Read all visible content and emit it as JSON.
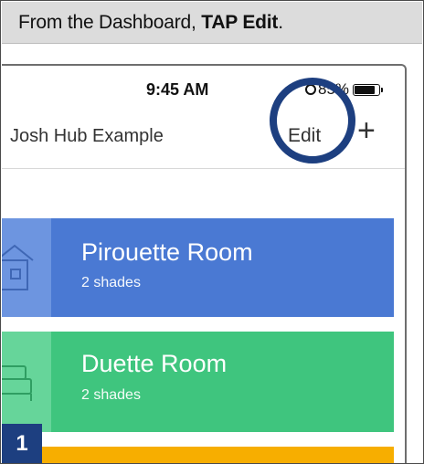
{
  "instruction": {
    "prefix": "From the Dashboard, ",
    "emphasis": "TAP Edit",
    "suffix": "."
  },
  "status_bar": {
    "time": "9:45 AM",
    "battery_percent_text": "85%",
    "battery_level": 0.85
  },
  "nav": {
    "hub_name": "Josh Hub Example",
    "edit_label": "Edit",
    "add_label": "+"
  },
  "rooms": [
    {
      "name": "Pirouette Room",
      "subtitle": "2 shades",
      "color": "#4a79d3",
      "icon": "house-icon"
    },
    {
      "name": "Duette Room",
      "subtitle": "2 shades",
      "color": "#3fc57e",
      "icon": "bed-icon"
    },
    {
      "name": "",
      "subtitle": "",
      "color": "#f7ae00",
      "icon": ""
    }
  ],
  "callout": {
    "highlight_color": "#1d3f80",
    "step_number": "1"
  }
}
